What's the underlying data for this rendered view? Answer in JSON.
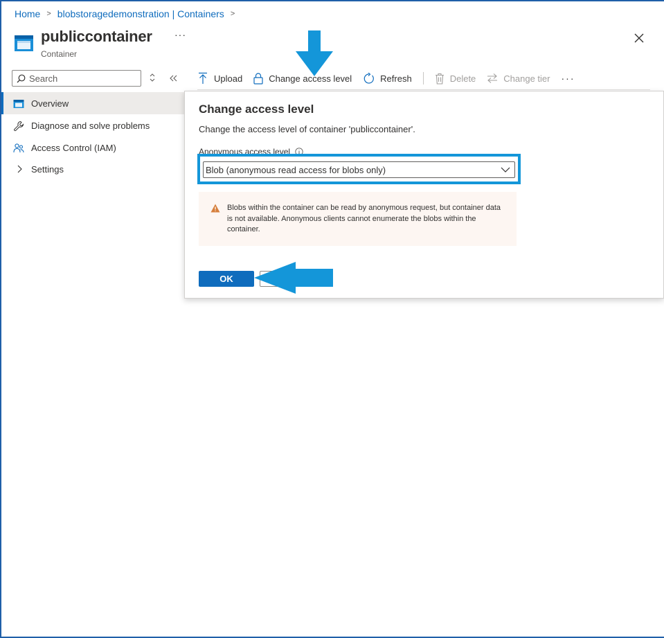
{
  "breadcrumb": {
    "home": "Home",
    "parent": "blobstoragedemonstration | Containers"
  },
  "header": {
    "title": "publiccontainer",
    "subtitle": "Container",
    "more": "···"
  },
  "search": {
    "placeholder": "Search"
  },
  "sidebar": {
    "items": [
      {
        "label": "Overview",
        "icon": "container-icon",
        "active": true
      },
      {
        "label": "Diagnose and solve problems",
        "icon": "wrench-icon"
      },
      {
        "label": "Access Control (IAM)",
        "icon": "people-icon"
      },
      {
        "label": "Settings",
        "icon": "chevron-right-icon"
      }
    ]
  },
  "toolbar": {
    "upload": "Upload",
    "change_access": "Change access level",
    "refresh": "Refresh",
    "delete": "Delete",
    "change_tier": "Change tier",
    "more": "···"
  },
  "dialog": {
    "title": "Change access level",
    "description": "Change the access level of container 'publiccontainer'.",
    "field_label": "Anonymous access level",
    "selected_value": "Blob (anonymous read access for blobs only)",
    "warning": "Blobs within the container can be read by anonymous request, but container data is not available. Anonymous clients cannot enumerate the blobs within the container.",
    "ok": "OK"
  },
  "colors": {
    "accent": "#0f6cbd",
    "annotation": "#1496d9",
    "warning_bg": "#fdf6f2",
    "warning_icon": "#d67f3c"
  }
}
